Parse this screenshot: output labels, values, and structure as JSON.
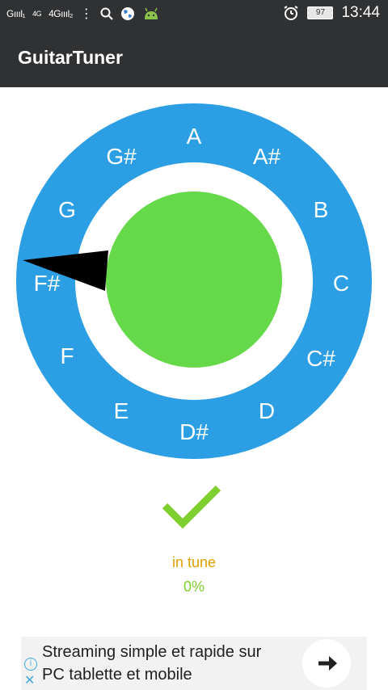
{
  "status_bar": {
    "signal_1": "Gıııl₁",
    "network": "4G",
    "signal_2": "4Gıııl₂",
    "menu_glyph": "⋮",
    "battery": "97",
    "time": "13:44",
    "icons": [
      "search-icon",
      "globe-icon",
      "android-icon",
      "alarm-icon"
    ]
  },
  "app_bar": {
    "title": "GuitarTuner"
  },
  "tuner": {
    "notes": [
      "A",
      "A#",
      "B",
      "C",
      "C#",
      "D",
      "D#",
      "E",
      "F",
      "F#",
      "G",
      "G#"
    ],
    "indicated_note": "F#",
    "colors": {
      "ring": "#2b9ee4",
      "center": "#66d94a",
      "needle": "#000000",
      "gap": "#ffffff"
    }
  },
  "status": {
    "label": "in tune",
    "percent": "0%",
    "colors": {
      "check": "#7fcf2f",
      "label": "#e0a000",
      "percent": "#7fcf2f"
    }
  },
  "ad": {
    "line1": "Streaming simple et rapide sur",
    "line2": "PC tablette et mobile",
    "info_glyph": "i",
    "close_glyph": "✕"
  }
}
